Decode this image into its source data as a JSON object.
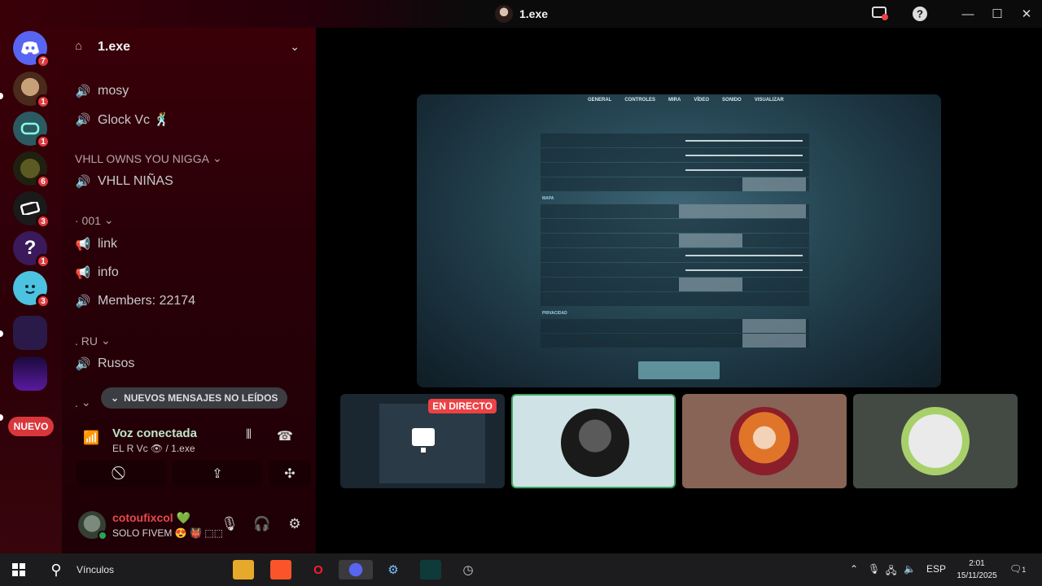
{
  "window": {
    "title": "1.exe"
  },
  "guild": {
    "name": "1.exe"
  },
  "servers": [
    {
      "name": "discord-home",
      "badge": "7",
      "color": "#5865f2"
    },
    {
      "name": "server-2",
      "badge": "1",
      "color": "#6b3f2a"
    },
    {
      "name": "server-3",
      "badge": "1",
      "color": "#2b5a62"
    },
    {
      "name": "server-4",
      "badge": "6",
      "color": "#3a3a22"
    },
    {
      "name": "server-5",
      "badge": "3",
      "color": "#1a1a1a"
    },
    {
      "name": "server-6",
      "badge": "1",
      "color": "#5a2a84"
    },
    {
      "name": "server-7",
      "badge": "3",
      "color": "#4cc3e0"
    },
    {
      "name": "server-8",
      "badge": "",
      "color": "#3a2a5a"
    },
    {
      "name": "server-9",
      "badge": "",
      "color": "#2a1a4a"
    }
  ],
  "nuevo_label": "NUEVO",
  "channels": {
    "mosy": "mosy",
    "glock": "Glock Vc 🕺",
    "cat_vhll": "VHLL OWNS YOU NIGGA",
    "vhll_ninas": "VHLL NIÑAS",
    "cat_001": "· 001",
    "link": "link",
    "info": "info",
    "members": "Members: 22174",
    "cat_ru": ". RU",
    "rusos": "Rusos",
    "cat_dot": "."
  },
  "unread_label": "NUEVOS MENSAJES NO LEÍDOS",
  "voice": {
    "title": "Voz conectada",
    "sub": "EL R Vc",
    "sub_channel": "/ 1.exe"
  },
  "user": {
    "name": "cotoufixcol 💚",
    "status": "SOLO FIVEM 😍 👹 ⬚⬚"
  },
  "screen": {
    "nav": [
      "GENERAL",
      "CONTROLES",
      "MIRA",
      "VÍDEO",
      "SONIDO",
      "VISUALIZAR"
    ],
    "section_map": "MAPA",
    "section_priv": "PRIVACIDAD"
  },
  "live_label": "EN DIRECTO",
  "taskbar": {
    "search_label": "Vínculos",
    "lang": "ESP",
    "time": "2:01",
    "date": "15/11/2025",
    "notif": "1"
  },
  "colors": {
    "accent": "#da373c",
    "voice_green": "#23a55a",
    "live_red": "#ed4245"
  }
}
